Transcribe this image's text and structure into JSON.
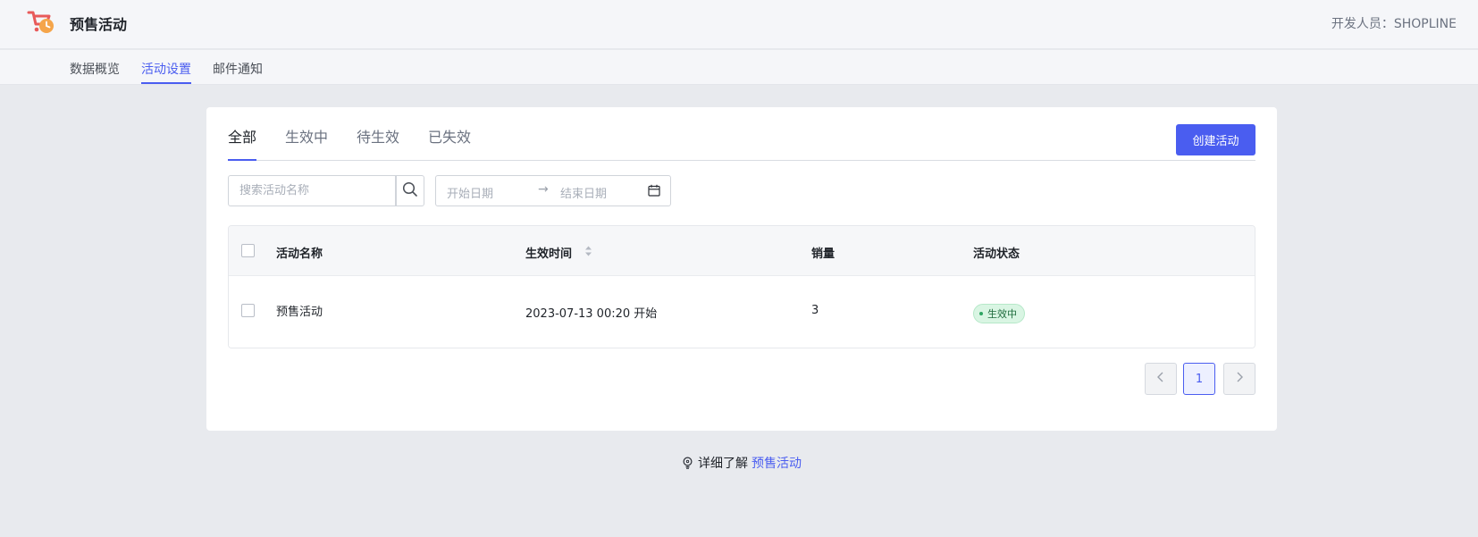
{
  "header": {
    "app_title": "预售活动",
    "developer": "开发人员：SHOPLINE",
    "logo_icon": "presale-cart-clock-logo"
  },
  "nav": {
    "tabs": [
      {
        "label": "数据概览",
        "active": false
      },
      {
        "label": "活动设置",
        "active": true
      },
      {
        "label": "邮件通知",
        "active": false
      }
    ]
  },
  "card": {
    "sub_tabs": [
      {
        "label": "全部",
        "active": true
      },
      {
        "label": "生效中",
        "active": false
      },
      {
        "label": "待生效",
        "active": false
      },
      {
        "label": "已失效",
        "active": false
      }
    ],
    "create_button": "创建活动",
    "search": {
      "placeholder": "搜索活动名称",
      "value": ""
    },
    "date_range": {
      "start_placeholder": "开始日期",
      "arrow": "→",
      "end_placeholder": "结束日期"
    },
    "table": {
      "columns": [
        "活动名称",
        "生效时间",
        "销量",
        "活动状态"
      ],
      "rows": [
        {
          "name": "预售活动",
          "time": "2023-07-13 00:20 开始",
          "sales": "3",
          "status": "生效中"
        }
      ]
    },
    "pagination": {
      "current_page": "1"
    }
  },
  "footer": {
    "text": "详细了解",
    "link": "预售活动"
  },
  "colors": {
    "accent": "#4a5df0",
    "status_active_bg": "#d9f5e3",
    "status_active_text": "#1e6b3c",
    "logo_cart": "#e85a5a",
    "logo_clock": "#f5a54a"
  }
}
